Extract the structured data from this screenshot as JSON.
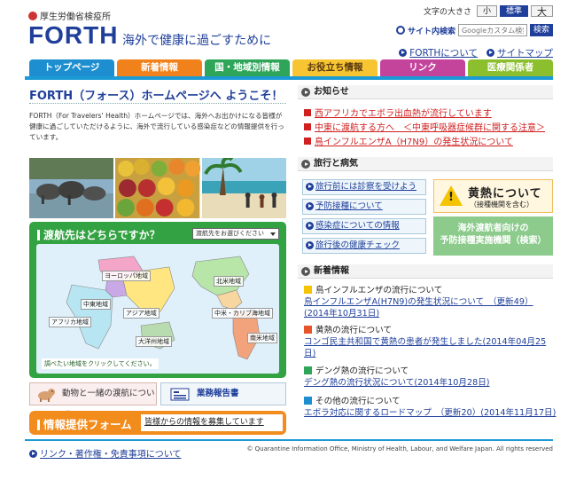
{
  "colors": {
    "brand": "#1f3f9a",
    "tab_bar": "#1b9ad6",
    "notice_red": "#d02020",
    "green": "#33a242",
    "orange": "#f28c1d"
  },
  "header": {
    "ministry": "厚生労働省検疫所",
    "logo": "FORTH",
    "tagline": "海外で健康に過ごすために",
    "text_size_label": "文字の大きさ",
    "text_size_options": [
      "小",
      "標準",
      "大"
    ],
    "search_label": "サイト内検索",
    "search_placeholder": "Googleカスタム検索",
    "search_button": "検索",
    "links": [
      "FORTHについて",
      "サイトマップ"
    ]
  },
  "tabs": [
    {
      "label": "トップページ",
      "color": "#1d8fd0"
    },
    {
      "label": "新着情報",
      "color": "#f1811a"
    },
    {
      "label": "国・地域別情報",
      "color": "#2fa55a"
    },
    {
      "label": "お役立ち情報",
      "color": "#f7c531"
    },
    {
      "label": "リンク",
      "color": "#c4449c"
    },
    {
      "label": "医療関係者",
      "color": "#8cbf2e"
    }
  ],
  "main": {
    "welcome": "FORTH（フォース）ホームページへ ようこそ！",
    "intro": "FORTH（For Travelers' Health）ホームページでは、海外へお出かけになる皆様が健康に過ごしていただけるように、海外で流行している感染症などの情報提供を行っています。",
    "map": {
      "question": "渡航先はどちらですか？",
      "select_placeholder": "渡航先をお選びください",
      "hint": "調べたい地域をクリックしてください。",
      "regions": [
        "ヨーロッパ地域",
        "北米地域",
        "中東地域",
        "アジア地域",
        "アフリカ地域",
        "中米・カリブ海地域",
        "大洋州地域",
        "南米地域"
      ]
    },
    "pets_button": "動物と一緒の渡航について",
    "report_button": "業務報告書",
    "info_title": "情報提供フォーム",
    "info_link": "皆様からの情報を募集しています"
  },
  "sidebar": {
    "notices_title": "お知らせ",
    "notices": [
      "西アフリカでエボラ出血熱が流行しています",
      "中東に渡航する方へ　＜中東呼吸器症候群に関する注意＞",
      "鳥インフルエンザA（H7N9）の発生状況について"
    ],
    "travel_title": "旅行と病気",
    "travel_links": [
      "旅行前には診察を受けよう",
      "予防接種について",
      "感染症についての情報",
      "旅行後の健康チェック"
    ],
    "yellow_fever_title": "黄熱について",
    "yellow_fever_sub": "（接種機関を含む）",
    "vaccination_line1": "海外渡航者向けの",
    "vaccination_line2": "予防接種実施機関（検索）",
    "news_title": "新着情報",
    "news": [
      {
        "title": "鳥インフルエンザの流行について",
        "link": "鳥インフルエンザA(H7N9)の発生状況について　（更新49）(2014年10月31日)",
        "icon_color": "#f5c400"
      },
      {
        "title": "黄熱の流行について",
        "link": "コンゴ民主共和国で黄熱の患者が発生しました(2014年04月25日)",
        "icon_color": "#e8542a"
      },
      {
        "title": "デング熱の流行について",
        "link": "デング熱の流行状況について(2014年10月28日)",
        "icon_color": "#2fa55a"
      },
      {
        "title": "その他の流行について",
        "link": "エボラ対応に関するロードマップ　（更新20）(2014年11月17日)",
        "icon_color": "#1d8fd0"
      }
    ]
  },
  "footer": {
    "link": "リンク・著作権・免責事項について",
    "copyright": "© Quarantine Information Office, Ministry of Health, Labour, and Welfare Japan. All rights reserved"
  }
}
